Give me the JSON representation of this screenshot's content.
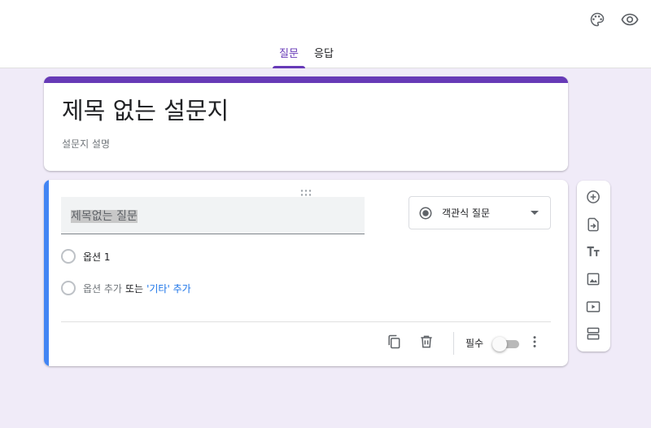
{
  "header": {
    "icons": {
      "palette": "palette-icon",
      "preview": "eye-icon"
    },
    "tabs": [
      {
        "label": "질문",
        "active": true
      },
      {
        "label": "응답",
        "active": false
      }
    ]
  },
  "form": {
    "title": "제목 없는 설문지",
    "description": "설문지 설명"
  },
  "question": {
    "title_value": "제목없는 질문",
    "type_label": "객관식 질문",
    "options": [
      {
        "label": "옵션 1"
      }
    ],
    "add_option": {
      "add_label": "옵션 추가",
      "or_label": "또는",
      "other_label": "'기타' 추가"
    },
    "required_label": "필수",
    "required": false
  },
  "side_toolbar": {
    "items": [
      {
        "icon": "add-circle-icon",
        "label": "질문 추가"
      },
      {
        "icon": "import-icon",
        "label": "질문 가져오기"
      },
      {
        "icon": "title-icon",
        "label": "제목 및 설명 추가"
      },
      {
        "icon": "image-icon",
        "label": "이미지 추가"
      },
      {
        "icon": "video-icon",
        "label": "동영상 추가"
      },
      {
        "icon": "section-icon",
        "label": "섹션 추가"
      }
    ]
  },
  "colors": {
    "accent": "#673ab7",
    "background": "#f0ebf8",
    "question_highlight": "#4285f4",
    "link": "#1a73e8"
  }
}
